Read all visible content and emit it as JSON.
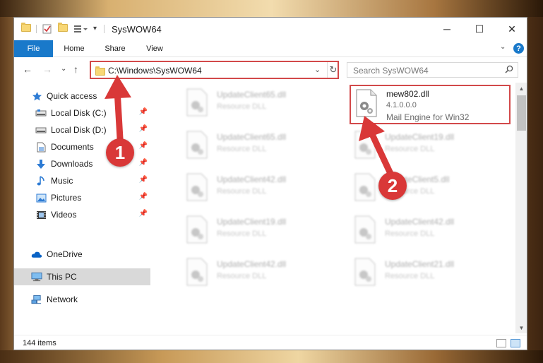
{
  "window": {
    "title": "SysWOW64"
  },
  "title_controls": {
    "minimize": "─",
    "maximize": "☐",
    "close": "✕"
  },
  "ribbon": {
    "tabs": [
      {
        "label": "File"
      },
      {
        "label": "Home"
      },
      {
        "label": "Share"
      },
      {
        "label": "View"
      }
    ],
    "expand_glyph": "⌄",
    "help_glyph": "?"
  },
  "nav": {
    "back": "←",
    "forward": "→",
    "recent": "⌄",
    "up": "↑",
    "address": "C:\\Windows\\SysWOW64",
    "address_chevron": "⌄",
    "refresh": "↻",
    "search_placeholder": "Search SysWOW64"
  },
  "sidebar": {
    "items": [
      {
        "label": "Quick access",
        "icon": "star-icon",
        "pinned": false
      },
      {
        "label": "Local Disk (C:)",
        "icon": "drive-icon",
        "pinned": true
      },
      {
        "label": "Local Disk (D:)",
        "icon": "drive-icon",
        "pinned": true
      },
      {
        "label": "Documents",
        "icon": "documents-icon",
        "pinned": true
      },
      {
        "label": "Downloads",
        "icon": "download-icon",
        "pinned": true
      },
      {
        "label": "Music",
        "icon": "music-icon",
        "pinned": true
      },
      {
        "label": "Pictures",
        "icon": "pictures-icon",
        "pinned": true
      },
      {
        "label": "Videos",
        "icon": "videos-icon",
        "pinned": true
      },
      {
        "label": "OneDrive",
        "icon": "cloud-icon",
        "pinned": false
      },
      {
        "label": "This PC",
        "icon": "computer-icon",
        "pinned": false,
        "selected": true
      },
      {
        "label": "Network",
        "icon": "network-icon",
        "pinned": false
      }
    ],
    "pin_glyph": "📌"
  },
  "files": {
    "left_column": [
      {
        "name": "UpdateClient65.dll",
        "type": "Resource DLL"
      },
      {
        "name": "UpdateClient65.dll",
        "type": "Resource DLL"
      },
      {
        "name": "UpdateClient42.dll",
        "type": "Resource DLL"
      },
      {
        "name": "UpdateClient19.dll",
        "type": "Resource DLL"
      },
      {
        "name": "UpdateClient42.dll",
        "type": "Resource DLL"
      }
    ],
    "highlighted": {
      "name": "mew802.dll",
      "version": "4.1.0.0.0",
      "description": "Mail Engine for Win32"
    },
    "right_column": [
      {
        "name": "UpdateClient19.dll",
        "type": "Resource DLL"
      },
      {
        "name": "UpdateClient5.dll",
        "type": "Resource DLL"
      },
      {
        "name": "UpdateClient42.dll",
        "type": "Resource DLL"
      },
      {
        "name": "UpdateClient21.dll",
        "type": "Resource DLL"
      }
    ]
  },
  "status": {
    "item_count": "144 items"
  },
  "annotations": [
    {
      "label": "1",
      "color": "#d93838"
    },
    {
      "label": "2",
      "color": "#d93838"
    }
  ]
}
